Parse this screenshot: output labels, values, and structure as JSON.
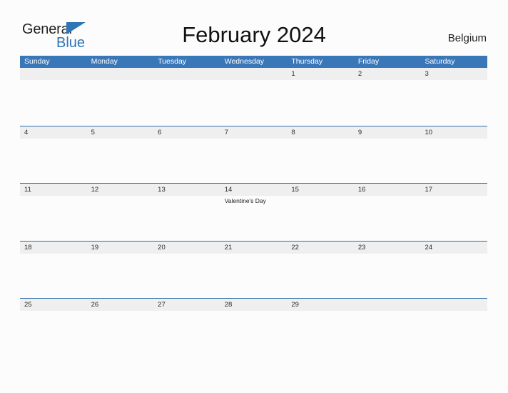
{
  "brand": {
    "name_part1": "General",
    "name_part2": "Blue",
    "accent_color": "#2e75b6"
  },
  "header": {
    "title": "February 2024",
    "country": "Belgium"
  },
  "calendar": {
    "header_color": "#3a77b8",
    "date_band_color": "#efefef",
    "row_border_color": "#2e6da4",
    "weekdays": [
      "Sunday",
      "Monday",
      "Tuesday",
      "Wednesday",
      "Thursday",
      "Friday",
      "Saturday"
    ],
    "weeks": [
      {
        "days": [
          {
            "number": "",
            "events": []
          },
          {
            "number": "",
            "events": []
          },
          {
            "number": "",
            "events": []
          },
          {
            "number": "",
            "events": []
          },
          {
            "number": "1",
            "events": []
          },
          {
            "number": "2",
            "events": []
          },
          {
            "number": "3",
            "events": []
          }
        ]
      },
      {
        "days": [
          {
            "number": "4",
            "events": []
          },
          {
            "number": "5",
            "events": []
          },
          {
            "number": "6",
            "events": []
          },
          {
            "number": "7",
            "events": []
          },
          {
            "number": "8",
            "events": []
          },
          {
            "number": "9",
            "events": []
          },
          {
            "number": "10",
            "events": []
          }
        ]
      },
      {
        "days": [
          {
            "number": "11",
            "events": []
          },
          {
            "number": "12",
            "events": []
          },
          {
            "number": "13",
            "events": []
          },
          {
            "number": "14",
            "events": [
              "Valentine's Day"
            ]
          },
          {
            "number": "15",
            "events": []
          },
          {
            "number": "16",
            "events": []
          },
          {
            "number": "17",
            "events": []
          }
        ]
      },
      {
        "days": [
          {
            "number": "18",
            "events": []
          },
          {
            "number": "19",
            "events": []
          },
          {
            "number": "20",
            "events": []
          },
          {
            "number": "21",
            "events": []
          },
          {
            "number": "22",
            "events": []
          },
          {
            "number": "23",
            "events": []
          },
          {
            "number": "24",
            "events": []
          }
        ]
      },
      {
        "days": [
          {
            "number": "25",
            "events": []
          },
          {
            "number": "26",
            "events": []
          },
          {
            "number": "27",
            "events": []
          },
          {
            "number": "28",
            "events": []
          },
          {
            "number": "29",
            "events": []
          },
          {
            "number": "",
            "events": []
          },
          {
            "number": "",
            "events": []
          }
        ]
      }
    ]
  }
}
